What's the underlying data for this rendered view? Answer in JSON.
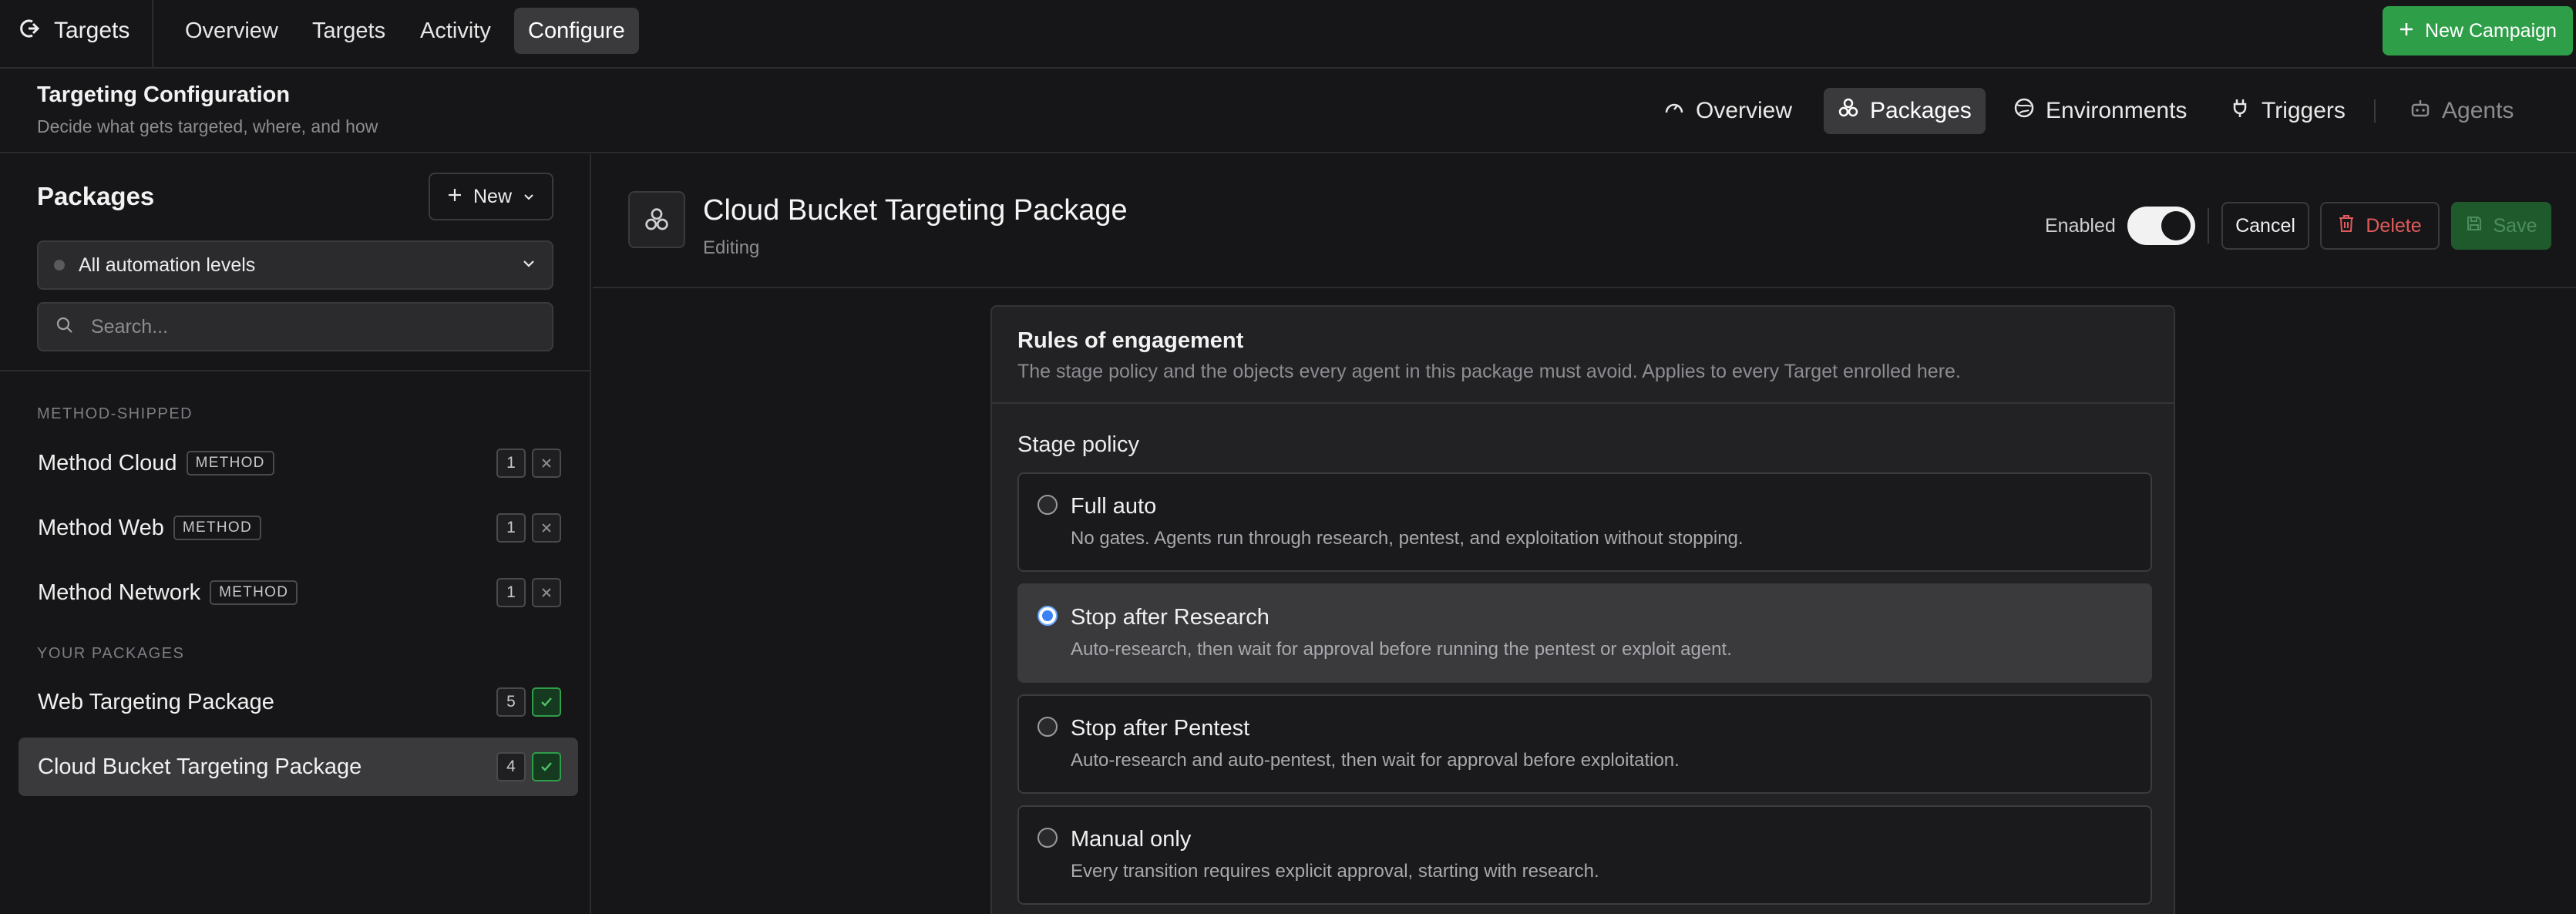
{
  "topnav": {
    "brand": "Targets",
    "tabs": [
      {
        "label": "Overview"
      },
      {
        "label": "Targets"
      },
      {
        "label": "Activity"
      },
      {
        "label": "Configure"
      }
    ],
    "new_campaign": "New Campaign"
  },
  "subheader": {
    "title": "Targeting Configuration",
    "subtitle": "Decide what gets targeted, where, and how",
    "tabs": [
      {
        "label": "Overview",
        "icon": "gauge-icon"
      },
      {
        "label": "Packages",
        "icon": "packages-icon"
      },
      {
        "label": "Environments",
        "icon": "globe-icon"
      },
      {
        "label": "Triggers",
        "icon": "plug-icon"
      },
      {
        "label": "Agents",
        "icon": "bot-icon"
      }
    ]
  },
  "sidebar": {
    "title": "Packages",
    "new_label": "New",
    "filter_value": "All automation levels",
    "search_placeholder": "Search...",
    "section_shipped": "METHOD-SHIPPED",
    "section_yours": "YOUR PACKAGES",
    "shipped": [
      {
        "name": "Method Cloud",
        "tag": "METHOD",
        "count": "1"
      },
      {
        "name": "Method Web",
        "tag": "METHOD",
        "count": "1"
      },
      {
        "name": "Method Network",
        "tag": "METHOD",
        "count": "1"
      }
    ],
    "yours": [
      {
        "name": "Web Targeting Package",
        "count": "5"
      },
      {
        "name": "Cloud Bucket Targeting Package",
        "count": "4"
      }
    ]
  },
  "main": {
    "title": "Cloud Bucket Targeting Package",
    "subtitle": "Editing",
    "enabled_label": "Enabled",
    "cancel": "Cancel",
    "delete": "Delete",
    "save": "Save",
    "card": {
      "title": "Rules of engagement",
      "description": "The stage policy and the objects every agent in this package must avoid. Applies to every Target enrolled here.",
      "stage_label": "Stage policy",
      "options": [
        {
          "label": "Full auto",
          "desc": "No gates. Agents run through research, pentest, and exploitation without stopping."
        },
        {
          "label": "Stop after Research",
          "desc": "Auto-research, then wait for approval before running the pentest or exploit agent."
        },
        {
          "label": "Stop after Pentest",
          "desc": "Auto-research and auto-pentest, then wait for approval before exploitation."
        },
        {
          "label": "Manual only",
          "desc": "Every transition requires explicit approval, starting with research."
        }
      ]
    }
  },
  "colors": {
    "background": "#161618",
    "accent_green": "#2f9e49",
    "danger": "#e05a5a",
    "radio_selected": "#3b82f6"
  }
}
